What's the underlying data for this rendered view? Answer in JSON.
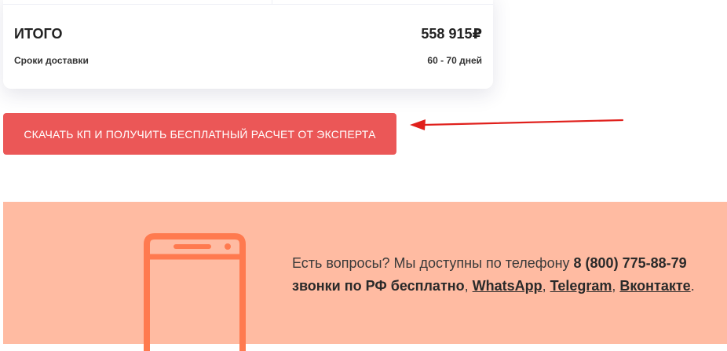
{
  "summary": {
    "total_label": "ИТОГО",
    "total_value": "558 915₽",
    "delivery_label": "Сроки доставки",
    "delivery_value": "60 - 70 дней"
  },
  "cta": {
    "label": "СКАЧАТЬ КП И ПОЛУЧИТЬ БЕСПЛАТНЫЙ РАСЧЕТ ОТ ЭКСПЕРТА",
    "color": "#eb5757"
  },
  "annotation": {
    "arrow_color": "#e0201c"
  },
  "contact": {
    "intro": "Есть вопросы? Мы доступны по телефону ",
    "phone": "8 (800) 775-88-79",
    "free_calls": "звонки по РФ бесплатно",
    "comma1": ", ",
    "whatsapp": "WhatsApp",
    "comma2": ", ",
    "telegram": "Telegram",
    "comma3": ", ",
    "vk": "Вконтакте",
    "end": ".",
    "banner_color": "#ffbba2",
    "icon": "smartphone-icon"
  }
}
